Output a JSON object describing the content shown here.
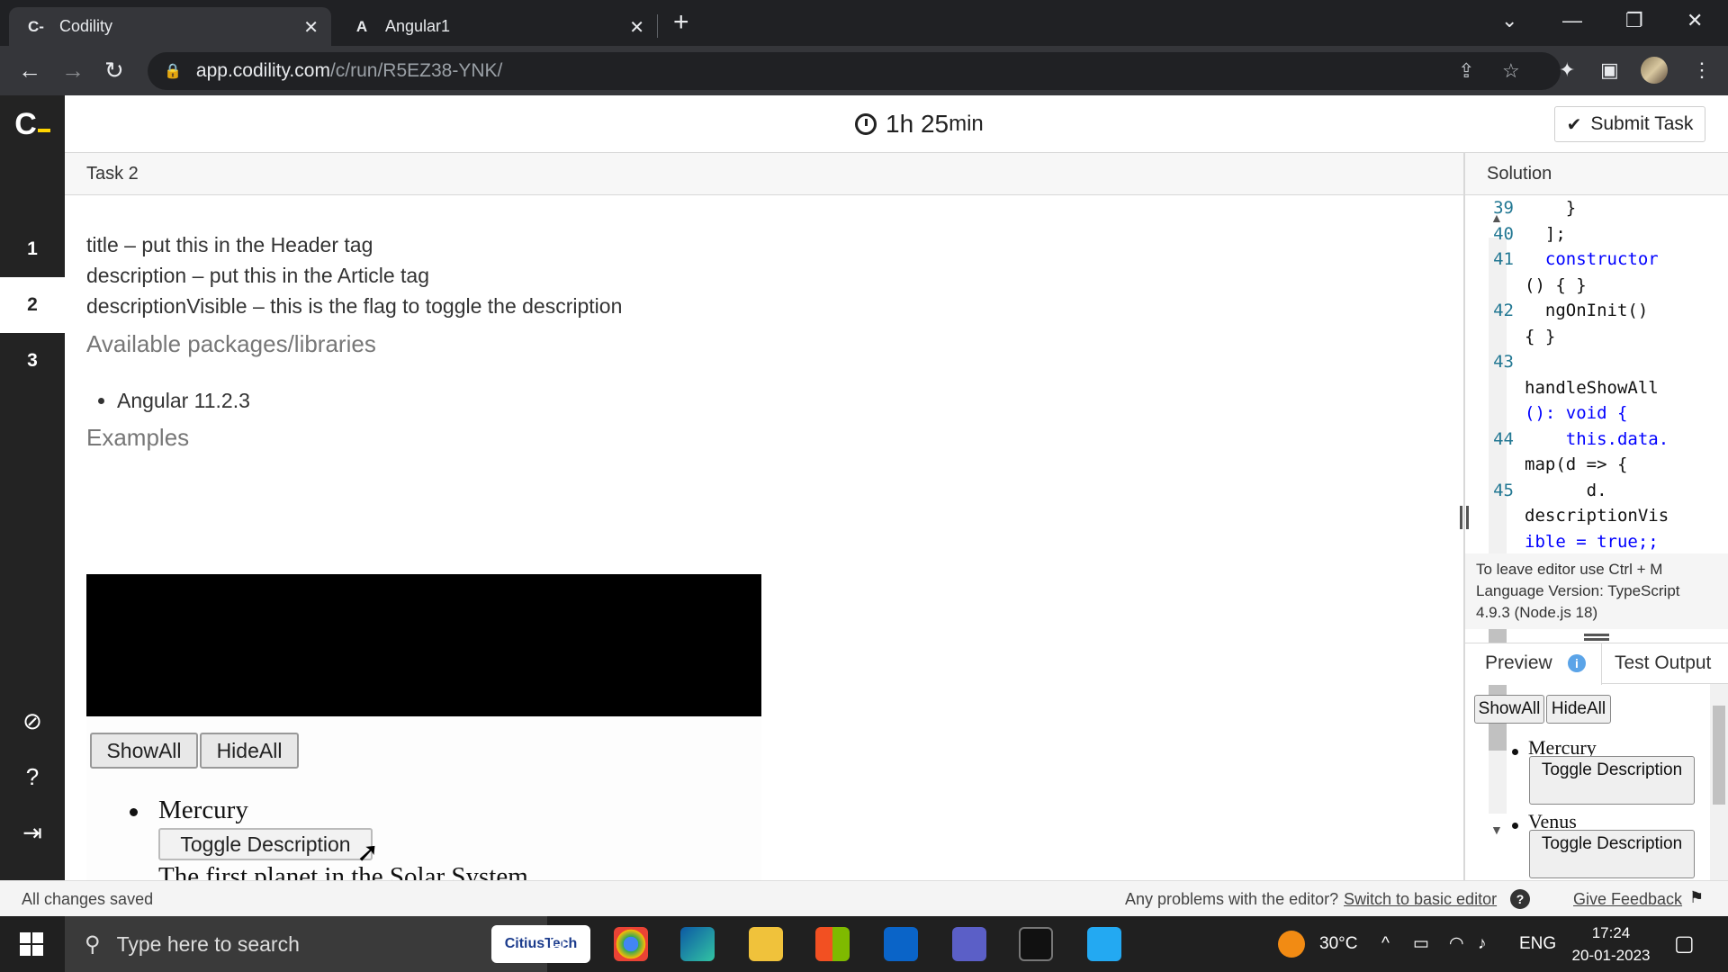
{
  "browser": {
    "tabs": [
      {
        "title": "Codility",
        "favicon": "C-"
      },
      {
        "title": "Angular1",
        "favicon": "A"
      }
    ],
    "url_host": "app.codility.com",
    "url_path": "/c/run/R5EZ38-YNK/"
  },
  "app": {
    "logo": "C",
    "tasks": [
      "1",
      "2",
      "3"
    ],
    "active_task": "2",
    "timer_hours": "1h",
    "timer_minutes": "25",
    "timer_unit": "min",
    "submit_label": "Submit Task"
  },
  "task": {
    "title": "Task 2",
    "lines": [
      "title – put this in the Header tag",
      "description – put this in the Article tag",
      "descriptionVisible – this is the flag to toggle the description"
    ],
    "packages_heading": "Available packages/libraries",
    "packages": [
      "Angular 11.2.3"
    ],
    "examples_heading": "Examples",
    "example": {
      "show_all": "ShowAll",
      "hide_all": "HideAll",
      "item": "Mercury",
      "toggle": "Toggle Description",
      "description": "The first planet in the Solar System"
    }
  },
  "solution": {
    "title": "Solution",
    "code_lines": [
      {
        "num": "39",
        "text": "    }"
      },
      {
        "num": "40",
        "text": "  ];"
      },
      {
        "num": "41",
        "text": "  constructor"
      },
      {
        "num": "",
        "text": "() { }"
      },
      {
        "num": "42",
        "text": "  ngOnInit()"
      },
      {
        "num": "",
        "text": "{ }"
      },
      {
        "num": "43",
        "text": ""
      },
      {
        "num": "",
        "text": "handleShowAll"
      },
      {
        "num": "",
        "text": "(): void {"
      },
      {
        "num": "44",
        "text": "    this.data."
      },
      {
        "num": "",
        "text": "map(d => {"
      },
      {
        "num": "45",
        "text": "      d."
      },
      {
        "num": "",
        "text": "descriptionVis"
      },
      {
        "num": "",
        "text": "ible = true;;"
      }
    ],
    "editor_hint": "To leave editor use Ctrl + M",
    "language_version": "Language Version: TypeScript 4.9.3 (Node.js 18)",
    "preview_tab": "Preview",
    "test_output_tab": "Test Output",
    "preview": {
      "show_all": "ShowAll",
      "hide_all": "HideAll",
      "items": [
        "Mercury",
        "Venus"
      ],
      "toggle": "Toggle Description"
    }
  },
  "status": {
    "saved": "All changes saved",
    "problem_text": "Any problems with the editor?",
    "switch_link": "Switch to basic editor",
    "feedback": "Give Feedback"
  },
  "taskbar": {
    "search_placeholder": "Type here to search",
    "citius": "CitiusTech",
    "temperature": "30°C",
    "language": "ENG",
    "time": "17:24",
    "date": "20-01-2023"
  },
  "colors": {
    "brand_yellow": "#ffd500",
    "sidebar_dark": "#232323",
    "code_keyword": "#0000ff",
    "line_number": "#237893"
  }
}
